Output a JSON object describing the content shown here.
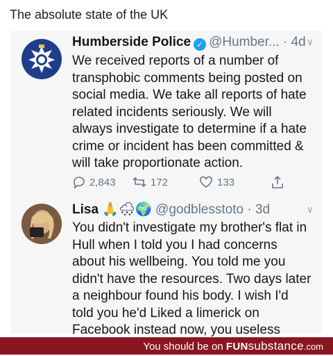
{
  "caption": "The absolute state of the UK",
  "tweets": [
    {
      "name": "Humberside Police",
      "handle": "@Humber... · 4d",
      "body": "We received reports of a number of transphobic comments being posted on social media. We take all reports of hate related incidents seriously. We will always investigate to determine if a hate crime or incident has been committed & will take proportionate action.",
      "replies": "2,843",
      "retweets": "172",
      "likes": "133",
      "verified": true
    },
    {
      "name": "Lisa",
      "emojis": "🙏🌨🌍",
      "handle": "@godblesstoto · 3d",
      "body": "You didn't investigate my brother's flat in Hull when I told you I had concerns about his wellbeing. You told me you didn't have the resources. Two days later a neighbour found his body. I wish I'd told you he'd Liked a limerick on Facebook instead now, you useless bastards."
    }
  ],
  "footer": {
    "prefix": "You should be on",
    "brand_fun": "FUN",
    "brand_rest": "substance",
    "suffix": ".com"
  }
}
